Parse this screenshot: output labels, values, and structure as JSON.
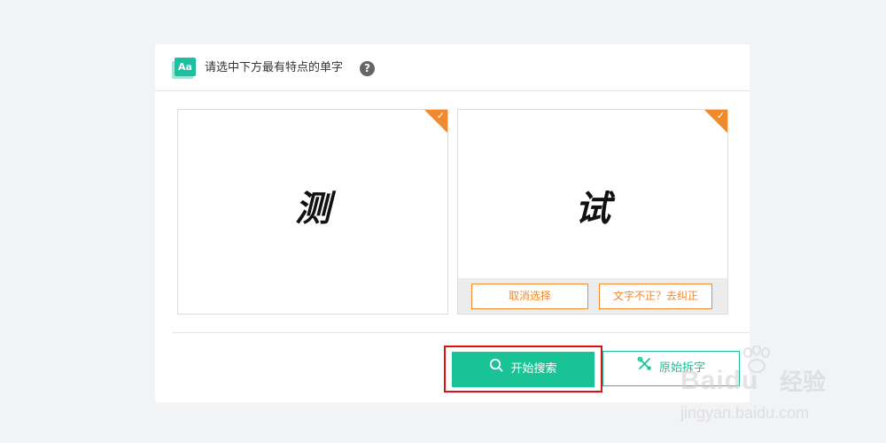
{
  "header": {
    "icon_text": "Aa",
    "title": "请选中下方最有特点的单字",
    "help_symbol": "?"
  },
  "cards": [
    {
      "char": "测",
      "selected": true
    },
    {
      "char": "试",
      "selected": true
    }
  ],
  "card_actions": {
    "cancel_label": "取消选择",
    "fix_label": "文字不正？去纠正"
  },
  "buttons": {
    "search_label": "开始搜索",
    "original_label": "原始拆字"
  },
  "watermark": {
    "brand": "Baidu",
    "product": "经验",
    "url": "jingyan.baidu.com"
  },
  "colors": {
    "accent_green": "#19c395",
    "accent_orange": "#f08a2e",
    "highlight_red": "#e01010",
    "check_mark": "✓"
  }
}
